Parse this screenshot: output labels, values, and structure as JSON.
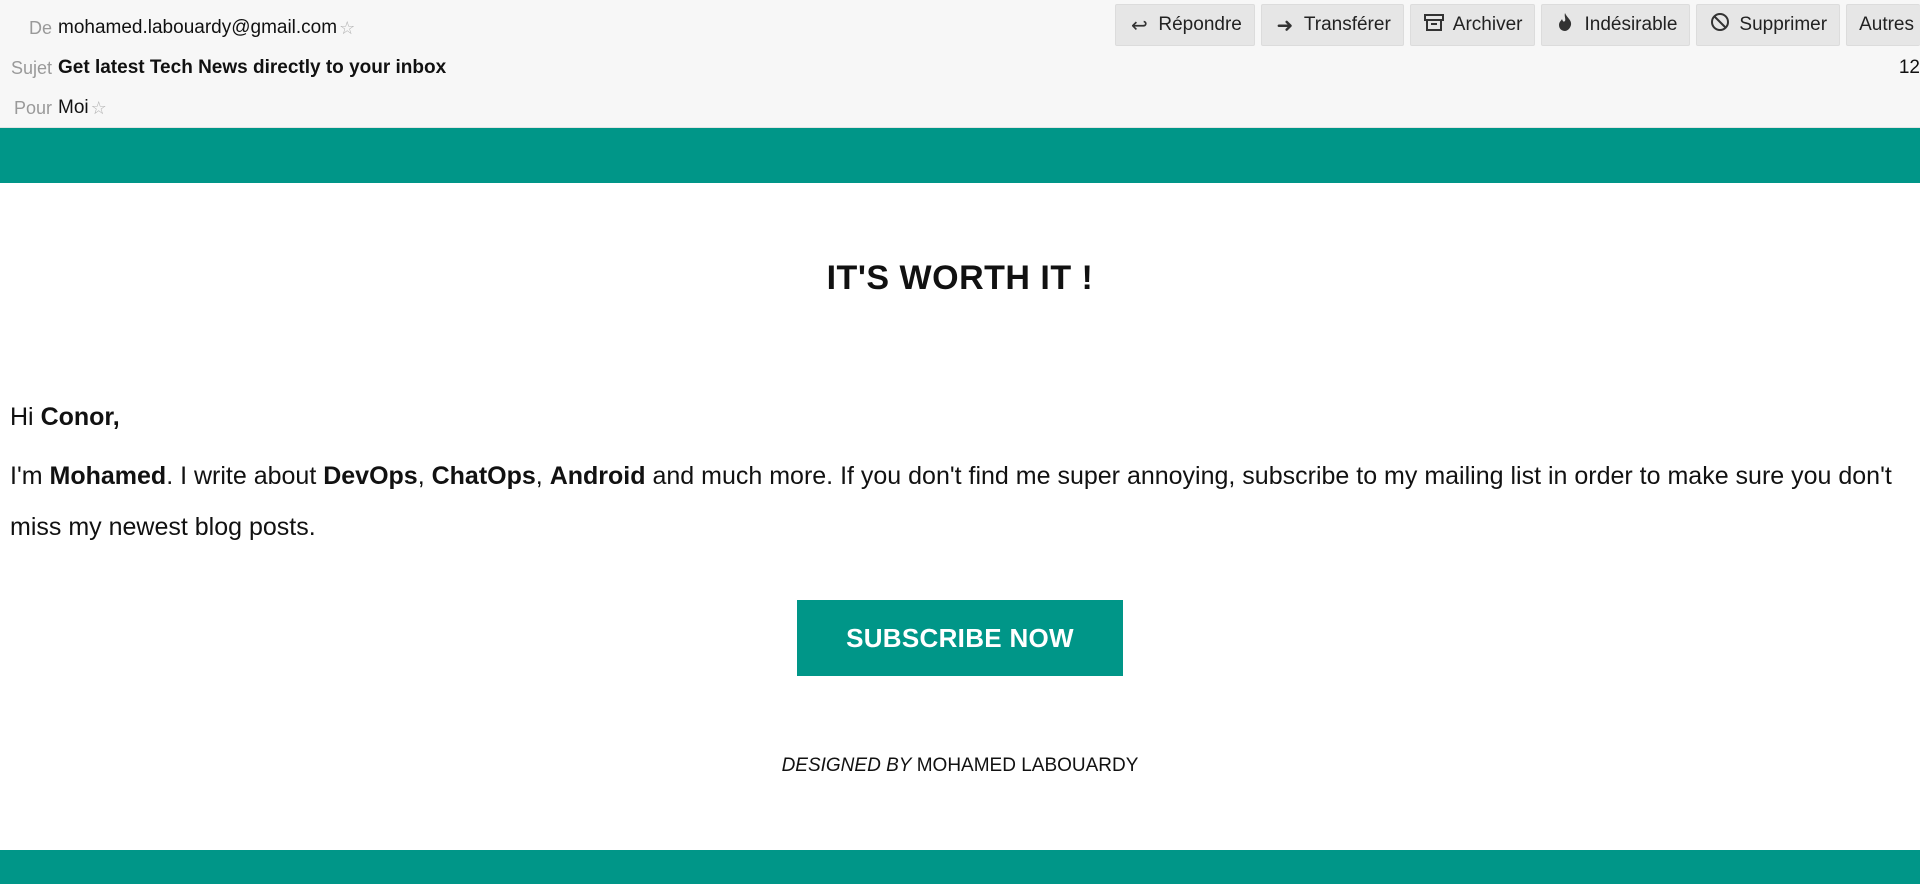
{
  "header": {
    "from_label": "De",
    "from_value": "mohamed.labouardy@gmail.com",
    "subject_label": "Sujet",
    "subject_value": "Get latest Tech News directly to your inbox",
    "to_label": "Pour",
    "to_value": "Moi",
    "time": "12",
    "toolbar": {
      "reply_label": "Répondre",
      "forward_label": "Transférer",
      "archive_label": "Archiver",
      "junk_label": "Indésirable",
      "delete_label": "Supprimer",
      "more_label": "Autres"
    }
  },
  "email": {
    "headline": "IT'S WORTH IT !",
    "greeting_prefix": "Hi ",
    "greeting_name": "Conor,",
    "intro_im": "I'm ",
    "intro_name": "Mohamed",
    "intro_write": ". I write about ",
    "topic_1": "DevOps",
    "sep_1": ", ",
    "topic_2": "ChatOps",
    "sep_2": ", ",
    "topic_3": "Android",
    "intro_rest": " and much more. If you don't find me super annoying, subscribe to my mailing list in order to make sure you don't miss my newest blog posts.",
    "cta_label": "SUBSCRIBE NOW",
    "credit_italic": "DESIGNED BY",
    "credit_name": " MOHAMED LABOUARDY"
  },
  "colors": {
    "accent": "#009688",
    "header_bg": "#f7f7f7",
    "toolbar_button_bg": "#e6e6e6"
  },
  "icons": {
    "reply": "reply-arrow-icon",
    "forward": "forward-arrow-icon",
    "archive": "archive-box-icon",
    "junk": "flame-icon",
    "delete": "prohibited-icon",
    "star": "star-outline-icon"
  }
}
